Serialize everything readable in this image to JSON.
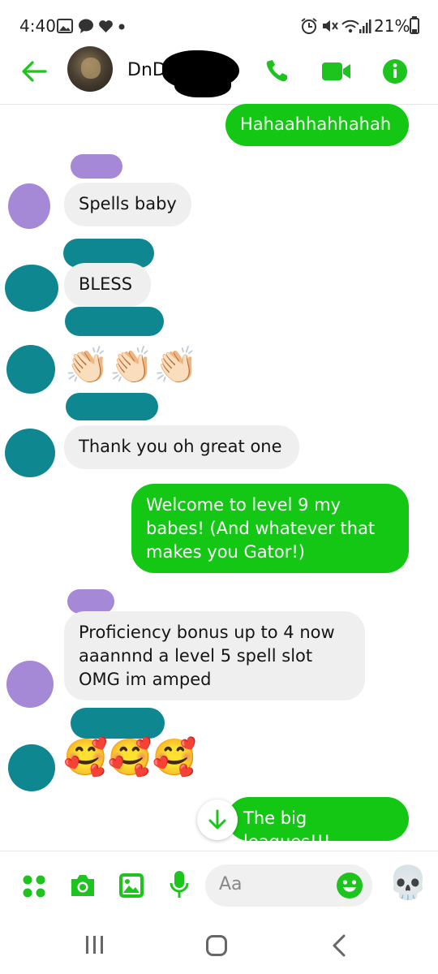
{
  "status_bar": {
    "time": "4:40",
    "battery": "21%",
    "left_icons": [
      "gallery-icon",
      "chat-bubble-icon",
      "heart-icon",
      "dot-icon"
    ],
    "right_icons": [
      "alarm-icon",
      "mute-icon",
      "wifi-icon",
      "signal-icon",
      "battery-icon"
    ]
  },
  "header": {
    "title": "DnD",
    "back_icon": "arrow-left-icon",
    "call_icon": "phone-icon",
    "video_icon": "video-camera-icon",
    "info_icon": "info-icon"
  },
  "colors": {
    "accent": "#14c714",
    "teal_marker": "#0f8791",
    "purple_marker": "#a588d6",
    "incoming_bg": "#efefef"
  },
  "messages": [
    {
      "dir": "out",
      "text": "Hahaahhahhahah"
    },
    {
      "dir": "in",
      "sender_color": "purple",
      "text": "Spells baby"
    },
    {
      "dir": "in",
      "sender_color": "teal",
      "text": "BLESS"
    },
    {
      "dir": "in",
      "sender_color": "teal",
      "text": "👏🏻👏🏻👏🏻"
    },
    {
      "dir": "in",
      "sender_color": "teal",
      "text": "Thank you oh great one"
    },
    {
      "dir": "out",
      "lines": [
        "Welcome to level 9 my",
        "babes! (And whatever that",
        "makes you Gator!)"
      ]
    },
    {
      "dir": "in",
      "sender_color": "purple",
      "lines": [
        "Proficiency bonus up to 4 now",
        "aaannnd a level 5 spell slot",
        "OMG im amped"
      ]
    },
    {
      "dir": "in",
      "sender_color": "teal",
      "text": "🥰🥰🥰"
    },
    {
      "dir": "out",
      "text": "The big leagues!!!"
    }
  ],
  "composer": {
    "placeholder": "Aa",
    "icons": [
      "apps-grid-icon",
      "camera-icon",
      "gallery-icon",
      "microphone-icon",
      "emoji-icon",
      "skull-icon"
    ],
    "quick_reaction": "💀"
  },
  "navbar": {
    "icons": [
      "recent-apps-icon",
      "home-icon",
      "back-icon"
    ]
  }
}
